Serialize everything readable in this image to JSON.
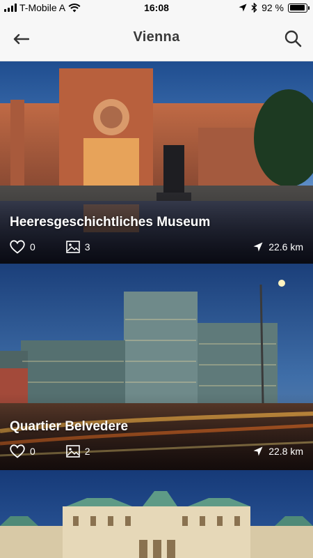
{
  "status_bar": {
    "carrier": "T-Mobile A",
    "time": "16:08",
    "battery_text": "92 %",
    "battery_level": 0.92
  },
  "header": {
    "title": "Vienna",
    "back_icon": "arrow-left-icon",
    "search_icon": "search-icon"
  },
  "cards": [
    {
      "title": "Heeresgeschichtliches Museum",
      "likes": "0",
      "photos": "3",
      "distance": "22.6 km"
    },
    {
      "title": "Quartier Belvedere",
      "likes": "0",
      "photos": "2",
      "distance": "22.8 km"
    },
    {
      "title": ""
    }
  ],
  "icons": {
    "like": "heart-icon",
    "photos": "image-icon",
    "distance": "navigation-arrow-icon"
  },
  "colors": {
    "header_bg": "#f7f7f7",
    "title_text": "#3a3a3a",
    "overlay_text": "#ffffff"
  }
}
